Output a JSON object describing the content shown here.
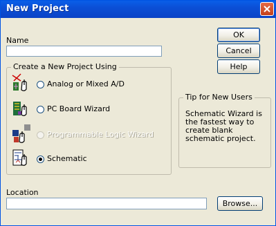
{
  "window": {
    "title": "New Project"
  },
  "name": {
    "label": "Name",
    "value": ""
  },
  "buttons": {
    "ok": "OK",
    "cancel": "Cancel",
    "help": "Help",
    "browse": "Browse..."
  },
  "create_group": {
    "legend": "Create a New Project Using",
    "options": [
      {
        "label": "Analog or Mixed A/D",
        "selected": false,
        "enabled": true,
        "icon": "analog-wizard-icon"
      },
      {
        "label": "PC Board Wizard",
        "selected": false,
        "enabled": true,
        "icon": "pcb-wizard-icon"
      },
      {
        "label": "Programmable Logic Wizard",
        "selected": false,
        "enabled": false,
        "icon": "programmable-logic-icon"
      },
      {
        "label": "Schematic",
        "selected": true,
        "enabled": true,
        "icon": "schematic-icon"
      }
    ]
  },
  "tip": {
    "legend": "Tip for New Users",
    "text": "Schematic Wizard is the fastest way to create blank schematic project."
  },
  "location": {
    "label": "Location",
    "value": ""
  },
  "colors": {
    "titlebar": "#0a4fd6",
    "close_button": "#d24b22",
    "dialog_bg": "#ece9d8"
  }
}
